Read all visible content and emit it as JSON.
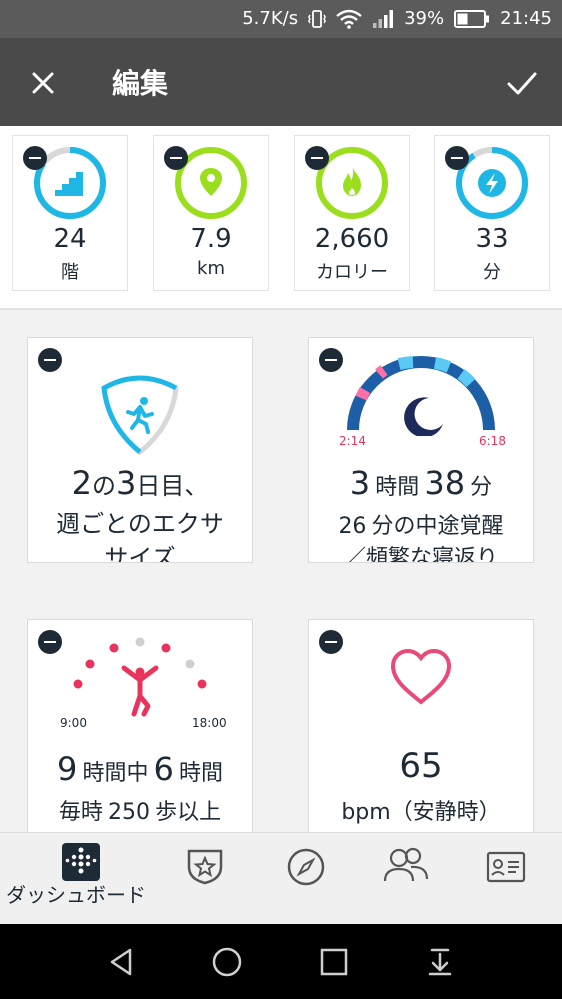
{
  "status_bar": {
    "speed": "5.7K/s",
    "battery": "39%",
    "time": "21:45"
  },
  "app_bar": {
    "title": "編集",
    "close_icon": "close-icon",
    "confirm_icon": "check-icon"
  },
  "stats": [
    {
      "value": "24",
      "unit": "階",
      "icon": "stairs-icon",
      "color": "#1fb8e6",
      "progress": 0.85
    },
    {
      "value": "7.9",
      "unit": "km",
      "icon": "location-pin-icon",
      "color": "#9ade1e",
      "progress": 1.0
    },
    {
      "value": "2,660",
      "unit": "カロリー",
      "icon": "flame-icon",
      "color": "#9ade1e",
      "progress": 1.0
    },
    {
      "value": "33",
      "unit": "分",
      "icon": "lightning-icon",
      "color": "#1fb8e6",
      "progress": 0.9
    }
  ],
  "exercise_card": {
    "line1_prefix": "2",
    "line1_mid": "の",
    "line1_num": "3",
    "line1_suffix": "日目、",
    "line2": "週ごとのエクサ",
    "line3": "サイズ"
  },
  "sleep_card": {
    "start_time": "2:14",
    "end_time": "6:18",
    "hours": "3",
    "hours_unit": "時間",
    "minutes": "38",
    "minutes_unit": "分",
    "line2_num": "26",
    "line2_text": "分の中途覚醒",
    "line3": "／頻繁な寝返り"
  },
  "hourly_card": {
    "start_time": "9:00",
    "end_time": "18:00",
    "total": "9",
    "total_unit": "時間中",
    "achieved": "6",
    "achieved_unit": "時間",
    "line2_prefix": "毎時",
    "line2_num": "250",
    "line2_suffix": "歩以上"
  },
  "heart_card": {
    "value": "65",
    "unit": "bpm（安静時）"
  },
  "bottom_nav": {
    "dashboard_label": "ダッシュボード"
  },
  "colors": {
    "accent_blue": "#1fb8e6",
    "accent_green": "#9ade1e",
    "accent_pink": "#e8335d",
    "navy": "#1e2a35"
  }
}
